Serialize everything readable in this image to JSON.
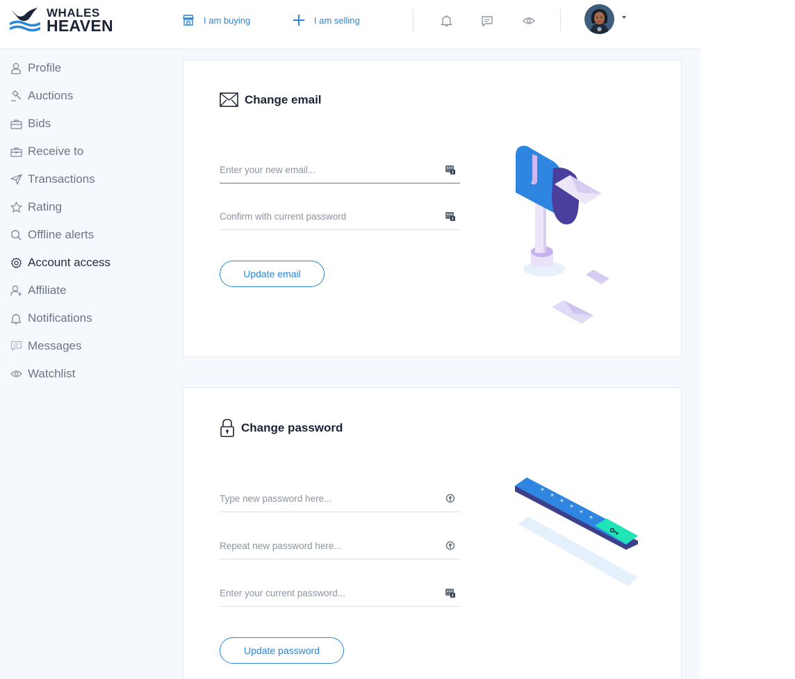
{
  "brand": {
    "line1": "WHALES",
    "line2": "HEAVEN"
  },
  "header": {
    "buying_label": "I am buying",
    "selling_label": "I am selling",
    "icons": [
      "bell-icon",
      "chat-icon",
      "eye-icon"
    ],
    "accent_color": "#2b86d6"
  },
  "sidebar": {
    "items": [
      {
        "label": "Profile",
        "icon": "user-icon",
        "active": false
      },
      {
        "label": "Auctions",
        "icon": "gavel-icon",
        "active": false
      },
      {
        "label": "Bids",
        "icon": "briefcase-icon",
        "active": false
      },
      {
        "label": "Receive to",
        "icon": "wallet-icon",
        "active": false
      },
      {
        "label": "Transactions",
        "icon": "paper-plane-icon",
        "active": false
      },
      {
        "label": "Rating",
        "icon": "star-icon",
        "active": false
      },
      {
        "label": "Offline alerts",
        "icon": "magnifier-icon",
        "active": false
      },
      {
        "label": "Account access",
        "icon": "gear-icon",
        "active": true
      },
      {
        "label": "Affiliate",
        "icon": "user-plus-icon",
        "active": false
      },
      {
        "label": "Notifications",
        "icon": "bell-icon",
        "active": false
      },
      {
        "label": "Messages",
        "icon": "chat-icon",
        "active": false
      },
      {
        "label": "Watchlist",
        "icon": "eye-icon",
        "active": false
      }
    ]
  },
  "email": {
    "title": "Change email",
    "new_email_placeholder": "Enter your new email...",
    "password_placeholder": "Confirm with current password",
    "button": "Update email"
  },
  "password": {
    "title": "Change password",
    "new_placeholder": "Type new password here...",
    "repeat_placeholder": "Repeat new password here...",
    "current_placeholder": "Enter your current password...",
    "button": "Update password"
  }
}
